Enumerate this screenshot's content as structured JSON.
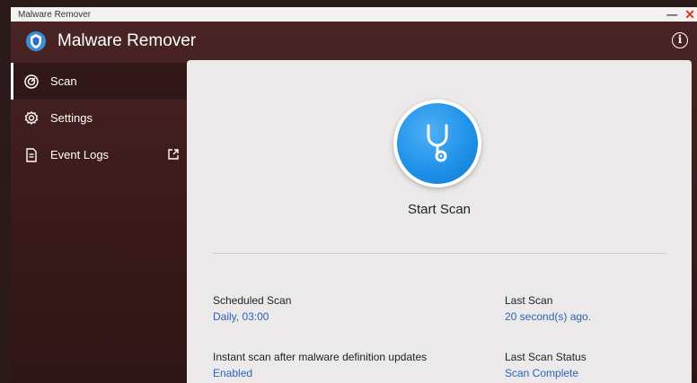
{
  "window": {
    "title": "Malware Remover",
    "minimize_label": "—",
    "close_label": "✕"
  },
  "header": {
    "app_title": "Malware Remover",
    "info_label": "i"
  },
  "sidebar": {
    "items": [
      {
        "label": "Scan",
        "icon": "scan-icon",
        "active": true
      },
      {
        "label": "Settings",
        "icon": "gear-icon",
        "active": false
      },
      {
        "label": "Event Logs",
        "icon": "document-icon",
        "active": false,
        "external": true
      }
    ]
  },
  "main": {
    "start_scan_label": "Start Scan",
    "scheduled_scan": {
      "label": "Scheduled Scan",
      "value": "Daily, 03:00"
    },
    "last_scan": {
      "label": "Last Scan",
      "value": "20 second(s) ago."
    },
    "instant_scan": {
      "label": "Instant scan after malware definition updates",
      "value": "Enabled"
    },
    "last_scan_status": {
      "label": "Last Scan Status",
      "value": "Scan Complete"
    }
  },
  "colors": {
    "accent": "#1c8fe8",
    "link_value": "#2e62b8",
    "background": "#3d1c1c",
    "panel": "#ebe9e9",
    "close": "#e0301e"
  }
}
